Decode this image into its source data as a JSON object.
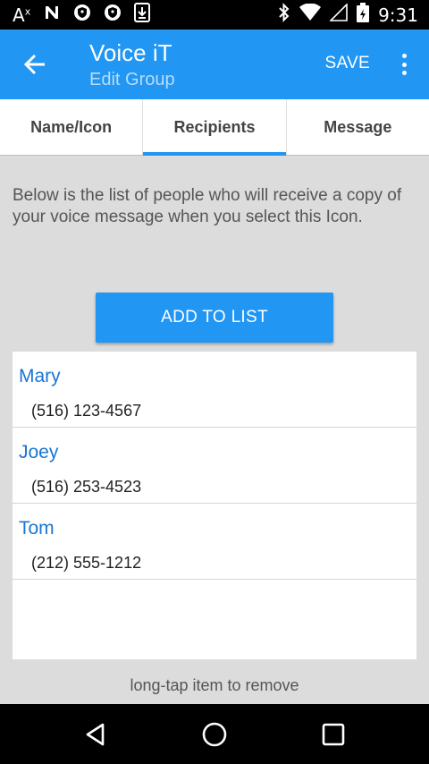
{
  "status_bar": {
    "left_text": "A",
    "left_sup": "x",
    "time": "9:31"
  },
  "app_bar": {
    "title": "Voice iT",
    "subtitle": "Edit Group",
    "save_label": "SAVE"
  },
  "tabs": [
    {
      "label": "Name/Icon",
      "active": false
    },
    {
      "label": "Recipients",
      "active": true
    },
    {
      "label": "Message",
      "active": false
    }
  ],
  "description": "Below is the list of people who will receive a copy of your voice message when you select this Icon.",
  "add_button_label": "ADD TO LIST",
  "recipients": [
    {
      "name": "Mary",
      "phone": "(516) 123-4567"
    },
    {
      "name": "Joey",
      "phone": "(516) 253-4523"
    },
    {
      "name": "Tom",
      "phone": "(212) 555-1212"
    }
  ],
  "hint": "long-tap item to remove",
  "colors": {
    "primary": "#2196f3",
    "name_text": "#1976d2",
    "background": "#dcdcdc"
  }
}
